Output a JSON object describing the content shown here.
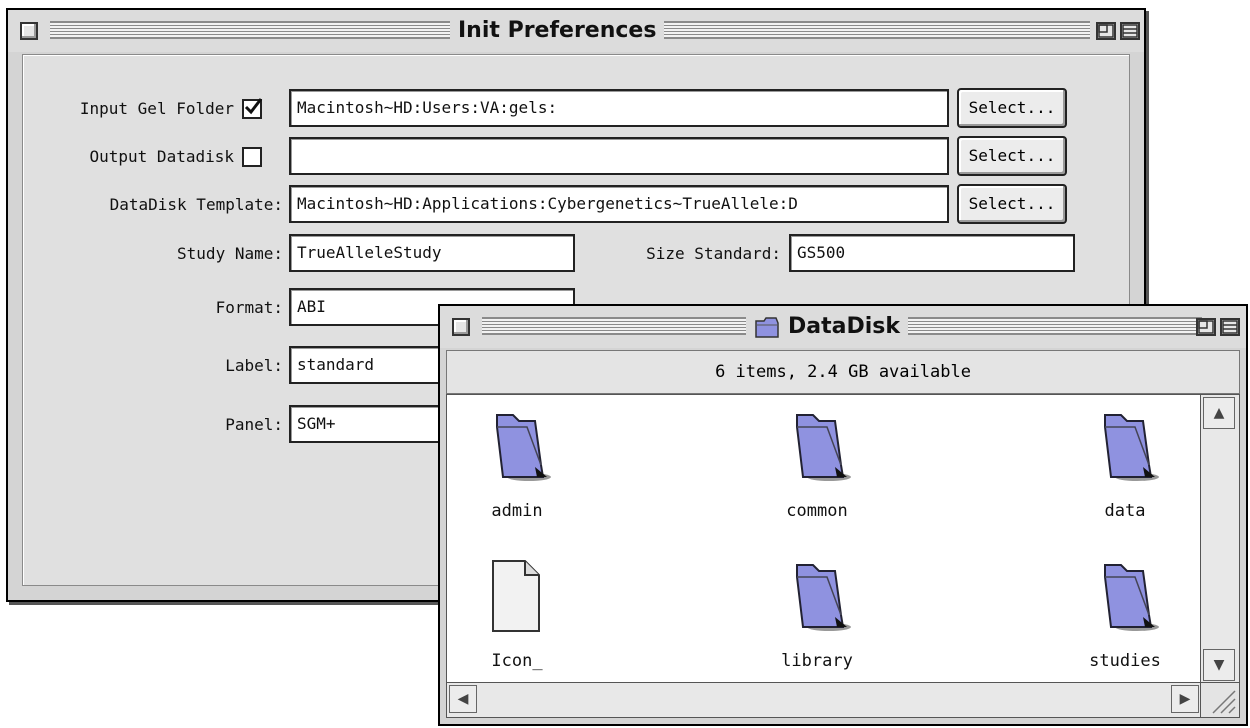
{
  "prefs_window": {
    "title": "Init Preferences",
    "input_gel_folder": {
      "label": "Input Gel Folder",
      "checked": true,
      "value": "Macintosh~HD:Users:VA:gels:",
      "button": "Select..."
    },
    "output_datadisk": {
      "label": "Output Datadisk",
      "checked": false,
      "value": "",
      "button": "Select..."
    },
    "datadisk_template": {
      "label": "DataDisk Template:",
      "value": "Macintosh~HD:Applications:Cybergenetics~TrueAllele:D",
      "button": "Select..."
    },
    "study_name": {
      "label": "Study Name:",
      "value": "TrueAlleleStudy"
    },
    "size_standard": {
      "label": "Size Standard:",
      "value": "GS500"
    },
    "format": {
      "label": "Format:",
      "value": "ABI"
    },
    "label_field": {
      "label": "Label:",
      "value": "standard"
    },
    "panel": {
      "label": "Panel:",
      "value": "SGM+"
    }
  },
  "datadisk_window": {
    "title": "DataDisk",
    "status": "6 items, 2.4 GB available",
    "items": [
      {
        "name": "admin",
        "type": "folder"
      },
      {
        "name": "common",
        "type": "folder"
      },
      {
        "name": "data",
        "type": "folder"
      },
      {
        "name": "Icon_",
        "type": "document"
      },
      {
        "name": "library",
        "type": "folder"
      },
      {
        "name": "studies",
        "type": "folder"
      }
    ]
  },
  "colors": {
    "window_bg": "#d4d4d4",
    "folder": "#8f92e0"
  }
}
